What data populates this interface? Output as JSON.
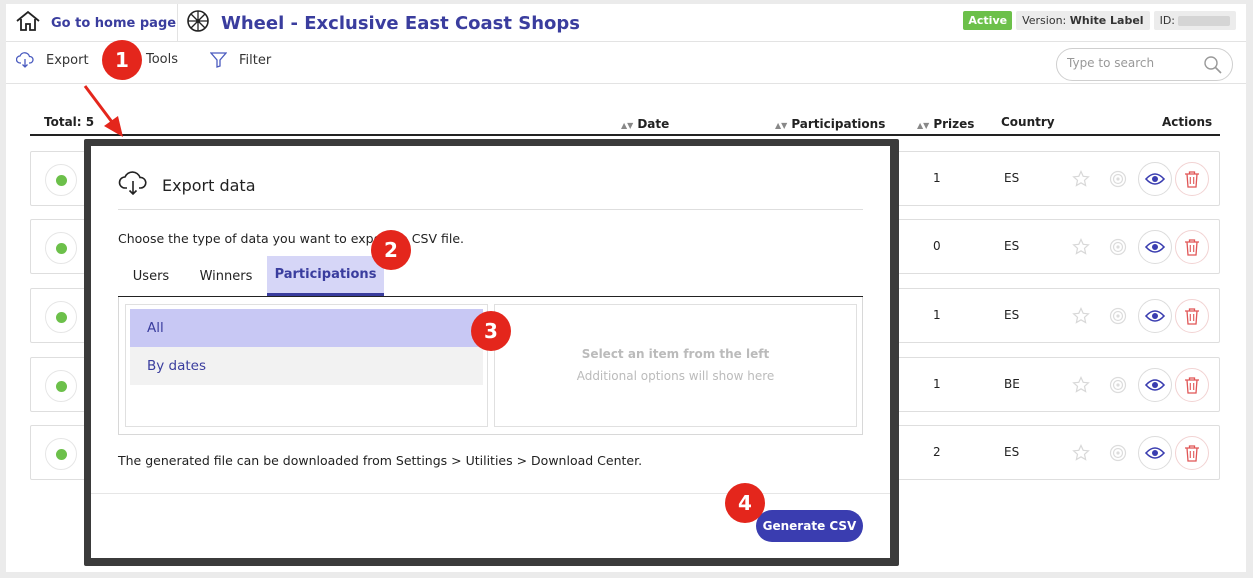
{
  "header": {
    "home_label": "Go to home page",
    "title": "Wheel - Exclusive East Coast Shops",
    "status": "Active",
    "version_prefix": "Version:",
    "version_value": "White Label",
    "id_label": "ID:"
  },
  "toolbar": {
    "export_label": "Export",
    "tools_label": "Tools",
    "filter_label": "Filter",
    "search_placeholder": "Type to search"
  },
  "table": {
    "total_label": "Total: 5",
    "columns": {
      "date": "Date",
      "participations": "Participations",
      "prizes": "Prizes",
      "country": "Country",
      "actions": "Actions"
    },
    "rows": [
      {
        "prizes": "1",
        "country": "ES"
      },
      {
        "prizes": "0",
        "country": "ES"
      },
      {
        "prizes": "1",
        "country": "ES"
      },
      {
        "prizes": "1",
        "country": "BE"
      },
      {
        "prizes": "2",
        "country": "ES"
      }
    ]
  },
  "modal": {
    "title": "Export data",
    "description": "Choose the type of data you want to export to CSV file.",
    "tabs": [
      "Users",
      "Winners",
      "Participations"
    ],
    "active_tab": "Participations",
    "options": [
      "All",
      "By dates"
    ],
    "selected_option": "All",
    "right_heading": "Select an item from the left",
    "right_sub": "Additional options will show here",
    "note": "The generated file can be downloaded from Settings > Utilities > Download Center.",
    "generate_label": "Generate CSV"
  },
  "callouts": [
    "1",
    "2",
    "3",
    "4"
  ],
  "colors": {
    "brand": "#3a3d9e",
    "active_green": "#6cc04a",
    "callout_red": "#e4261c",
    "tab_active_bg": "#d6d6f7",
    "option_selected_bg": "#c8c8f4"
  }
}
